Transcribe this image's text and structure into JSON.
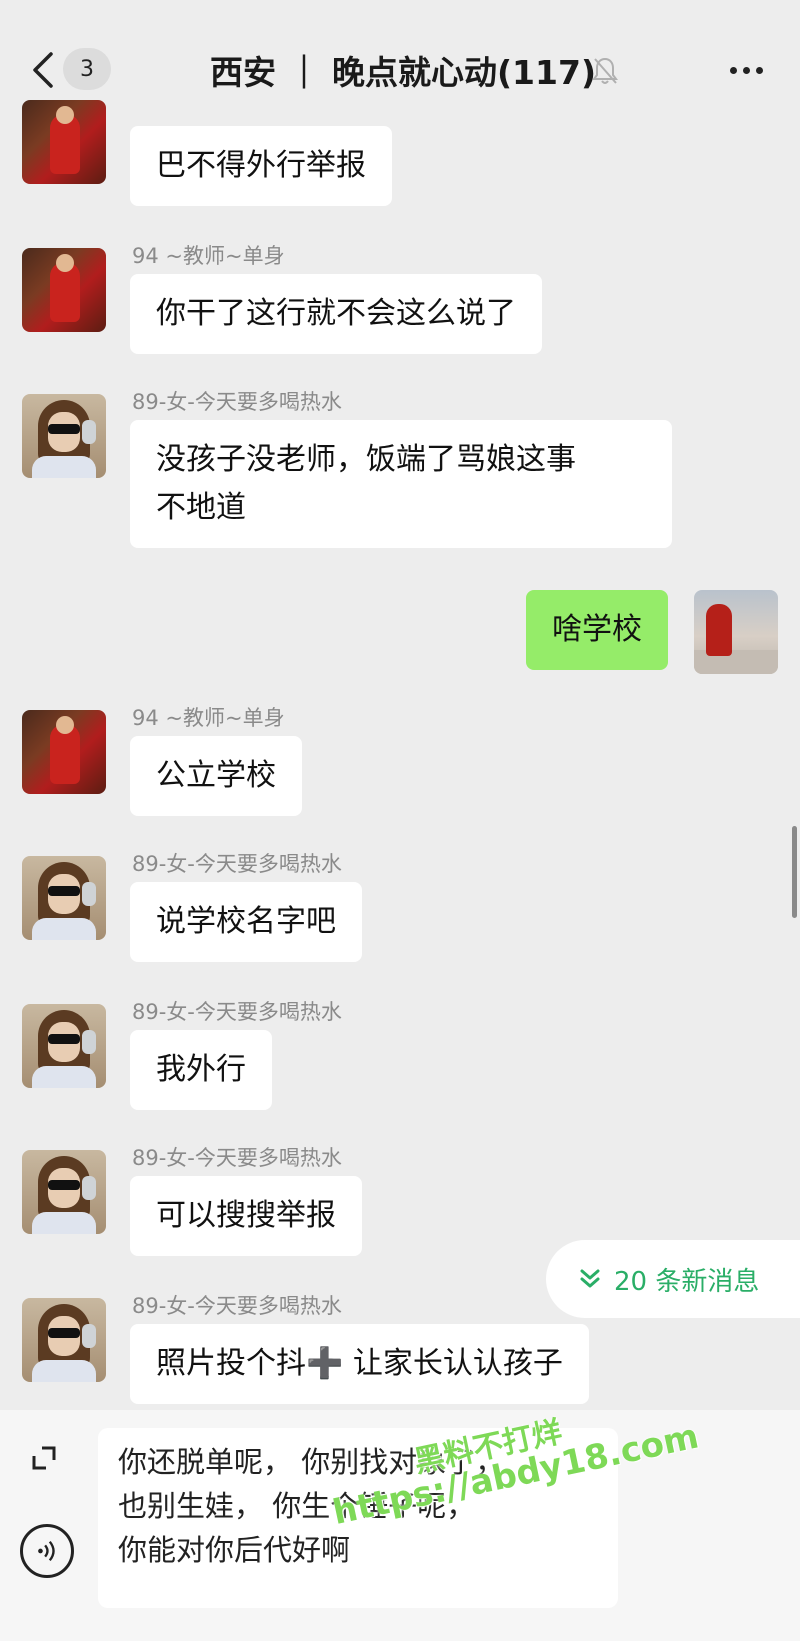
{
  "header": {
    "back_count": "3",
    "title": "西安 ｜ 晚点就心动(117)"
  },
  "messages": [
    {
      "sender": "",
      "text": "巴不得外行举报"
    },
    {
      "sender": "94 ~教师~单身",
      "text": "你干了这行就不会这么说了"
    },
    {
      "sender": "89-女-今天要多喝热水",
      "lines": [
        "没孩子没老师，饭端了骂娘这事",
        "不地道"
      ]
    },
    {
      "sender": "",
      "text": "啥学校"
    },
    {
      "sender": "94 ~教师~单身",
      "text": "公立学校"
    },
    {
      "sender": "89-女-今天要多喝热水",
      "text": "说学校名字吧"
    },
    {
      "sender": "89-女-今天要多喝热水",
      "text": "我外行"
    },
    {
      "sender": "89-女-今天要多喝热水",
      "text": "可以搜搜举报"
    },
    {
      "sender": "89-女-今天要多喝热水",
      "text": "照片投个抖➕ 让家长认认孩子"
    }
  ],
  "new_messages": "20 条新消息",
  "input": {
    "lines": [
      "你还脱单呢， 你别找对象了，",
      "也别生娃，   你生个锤子呢，",
      "你能对你后代好啊"
    ]
  },
  "watermark": {
    "line1": "黑料不打烊",
    "line2": "https://abdy18.com"
  },
  "colors": {
    "background": "#ededed",
    "my_bubble": "#95ec69",
    "other_bubble": "#ffffff",
    "accent_green": "#2aae67"
  }
}
